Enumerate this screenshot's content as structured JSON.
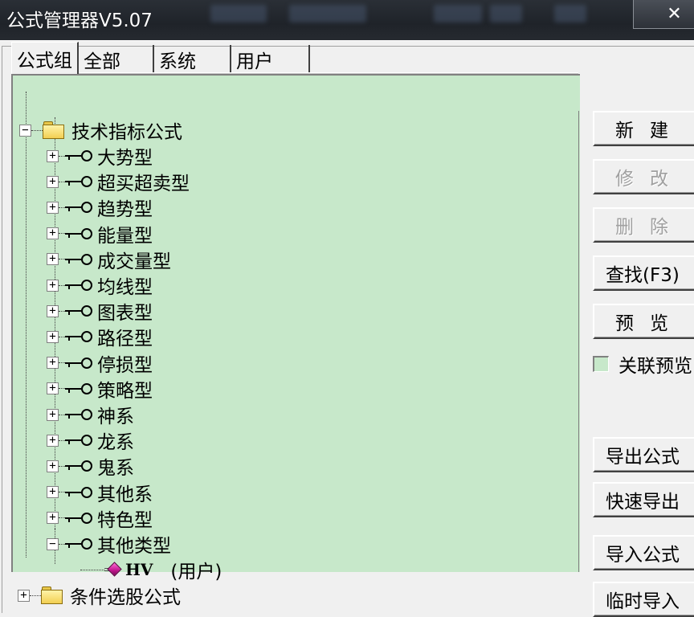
{
  "window": {
    "title": "公式管理器V5.07",
    "close_label": "✕"
  },
  "tabs": [
    {
      "label": "公式组",
      "active": true
    },
    {
      "label": "全部",
      "active": false
    },
    {
      "label": "系统",
      "active": false
    },
    {
      "label": "用户",
      "active": false
    }
  ],
  "tree": {
    "root": {
      "label": "技术指标公式",
      "expander": "−"
    },
    "children": [
      {
        "label": "大势型",
        "expander": "+"
      },
      {
        "label": "超买超卖型",
        "expander": "+"
      },
      {
        "label": "趋势型",
        "expander": "+"
      },
      {
        "label": "能量型",
        "expander": "+"
      },
      {
        "label": "成交量型",
        "expander": "+"
      },
      {
        "label": "均线型",
        "expander": "+"
      },
      {
        "label": "图表型",
        "expander": "+"
      },
      {
        "label": "路径型",
        "expander": "+"
      },
      {
        "label": "停损型",
        "expander": "+"
      },
      {
        "label": "策略型",
        "expander": "+"
      },
      {
        "label": "神系",
        "expander": "+"
      },
      {
        "label": "龙系",
        "expander": "+"
      },
      {
        "label": "鬼系",
        "expander": "+"
      },
      {
        "label": "其他系",
        "expander": "+"
      },
      {
        "label": "特色型",
        "expander": "+"
      },
      {
        "label": "其他类型",
        "expander": "−"
      }
    ],
    "leaf": {
      "code": "HV",
      "owner": "(用户)"
    },
    "root2": {
      "label": "条件选股公式",
      "expander": "+"
    }
  },
  "buttons": {
    "new": "新建",
    "modify": "修改",
    "delete": "删除",
    "find": "查找(F3)",
    "preview": "预览",
    "export": "导出公式",
    "quick_export": "快速导出",
    "import": "导入公式",
    "temp_import": "临时导入"
  },
  "checkbox": {
    "label": "关联预览",
    "checked": false
  },
  "colors": {
    "tree_background": "#c7e8ca",
    "titlebar": "#1f2329"
  }
}
